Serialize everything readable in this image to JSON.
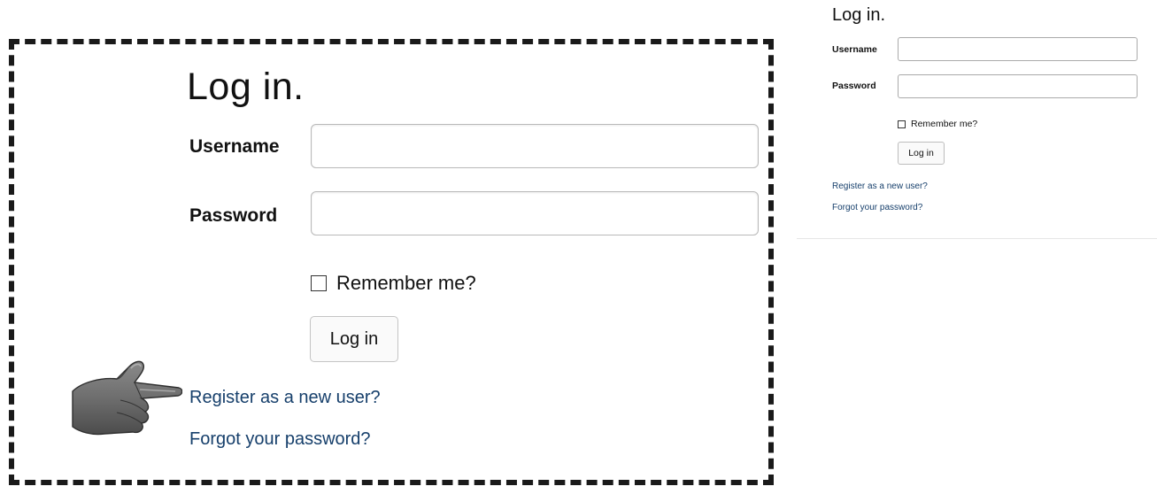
{
  "zoomed_form": {
    "title": "Log in.",
    "username_label": "Username",
    "username_value": "",
    "password_label": "Password",
    "password_value": "",
    "remember_label": "Remember me?",
    "remember_checked": false,
    "login_button": "Log in",
    "register_link": "Register as a new user?",
    "forgot_link": "Forgot your password?",
    "pointer_icon": "pointing-hand-icon"
  },
  "actual_form": {
    "title": "Log in.",
    "username_label": "Username",
    "username_value": "",
    "password_label": "Password",
    "password_value": "",
    "remember_label": "Remember me?",
    "remember_checked": false,
    "login_button": "Log in",
    "register_link": "Register as a new user?",
    "forgot_link": "Forgot your password?"
  },
  "colors": {
    "link": "#163f6b",
    "text": "#111111",
    "frame": "#1a1a1a"
  }
}
